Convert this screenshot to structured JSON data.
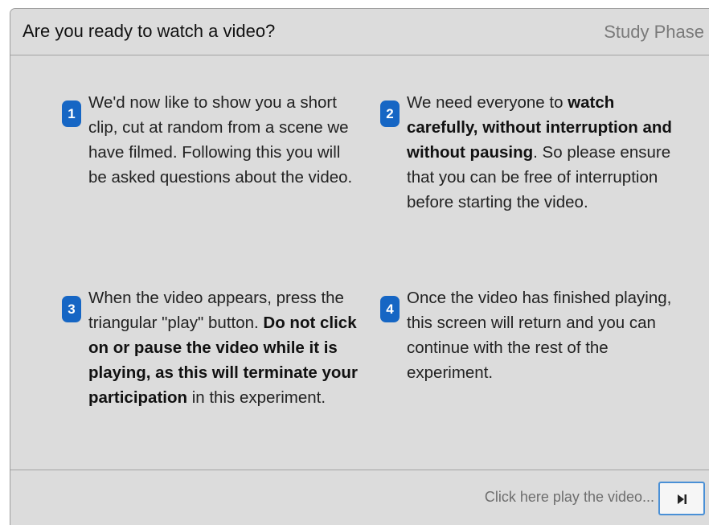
{
  "header": {
    "title": "Are you ready to watch a video?",
    "phase": "Study Phase"
  },
  "steps": [
    {
      "number": "1",
      "parts": [
        {
          "text": "We'd now like to show you a short clip, cut at random from a scene we have filmed. Following this you will be asked questions about the video.",
          "bold": false
        }
      ]
    },
    {
      "number": "2",
      "parts": [
        {
          "text": "We need everyone to ",
          "bold": false
        },
        {
          "text": "watch carefully, without interruption and without pausing",
          "bold": true
        },
        {
          "text": ". So please ensure that you can be free of interruption before starting the video.",
          "bold": false
        }
      ]
    },
    {
      "number": "3",
      "parts": [
        {
          "text": "When the video appears, press the triangular \"play\" button. ",
          "bold": false
        },
        {
          "text": "Do not click on or pause the video while it is playing, as this will terminate your participation",
          "bold": true
        },
        {
          "text": " in this experiment.",
          "bold": false
        }
      ]
    },
    {
      "number": "4",
      "parts": [
        {
          "text": "Once the video has finished playing, this screen will return and you can continue with the rest of the experiment.",
          "bold": false
        }
      ]
    }
  ],
  "footer": {
    "hint": "Click here play the video...",
    "play_icon": "play-next-icon"
  },
  "colors": {
    "panel_background": "#dcdcdc",
    "badge": "#1666c4",
    "button_border": "#4a90d6"
  }
}
